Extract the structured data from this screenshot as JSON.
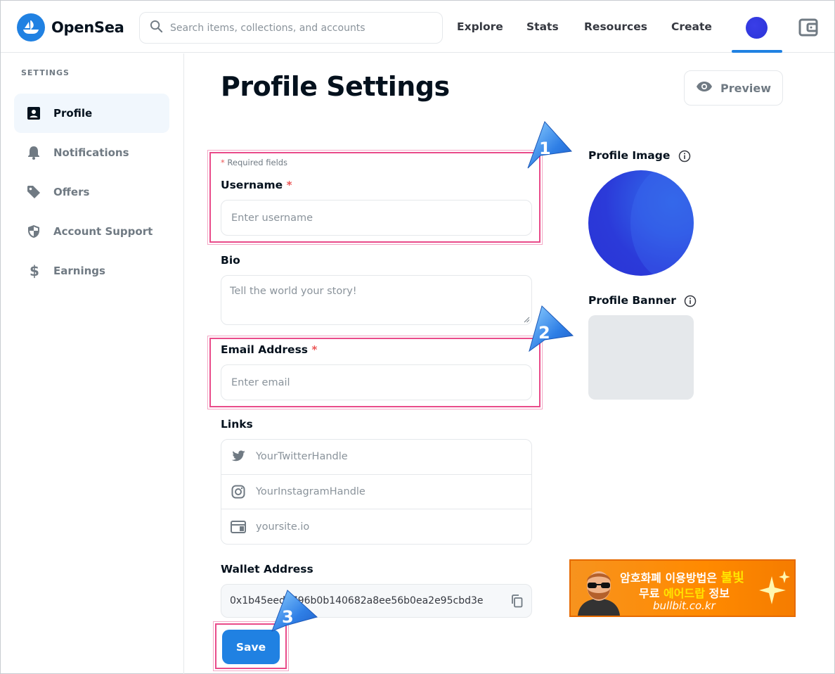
{
  "header": {
    "logo_text": "OpenSea",
    "search_placeholder": "Search items, collections, and accounts",
    "nav": [
      "Explore",
      "Stats",
      "Resources",
      "Create"
    ]
  },
  "sidebar": {
    "heading": "SETTINGS",
    "items": [
      {
        "label": "Profile",
        "icon": "profile-card-icon",
        "active": true
      },
      {
        "label": "Notifications",
        "icon": "bell-icon"
      },
      {
        "label": "Offers",
        "icon": "tag-icon"
      },
      {
        "label": "Account Support",
        "icon": "shield-icon"
      },
      {
        "label": "Earnings",
        "icon": "dollar-icon"
      }
    ]
  },
  "main": {
    "title": "Profile Settings",
    "preview_label": "Preview",
    "required_note": "Required fields",
    "username_label": "Username",
    "username_placeholder": "Enter username",
    "bio_label": "Bio",
    "bio_placeholder": "Tell the world your story!",
    "email_label": "Email Address",
    "email_placeholder": "Enter email",
    "links_label": "Links",
    "links": [
      {
        "icon": "twitter-icon",
        "placeholder": "YourTwitterHandle"
      },
      {
        "icon": "instagram-icon",
        "placeholder": "YourInstagramHandle"
      },
      {
        "icon": "website-icon",
        "placeholder": "yoursite.io"
      }
    ],
    "wallet_label": "Wallet Address",
    "wallet_address": "0x1b45eedb796b0b140682a8ee56b0ea2e95cbd3e",
    "save_label": "Save",
    "profile_image_label": "Profile Image",
    "profile_banner_label": "Profile Banner"
  },
  "annotations": [
    "1",
    "2",
    "3"
  ],
  "ad": {
    "line1_a": "암호화폐 이용방법은",
    "line1_b": "불빛",
    "line2_a": "무료",
    "line2_b": "에어드랍",
    "line2_c": "정보",
    "line3": "bullbit.co.kr"
  },
  "colors": {
    "accent": "#2081e2",
    "annotation": "#e94b8a",
    "required": "#eb5757"
  }
}
